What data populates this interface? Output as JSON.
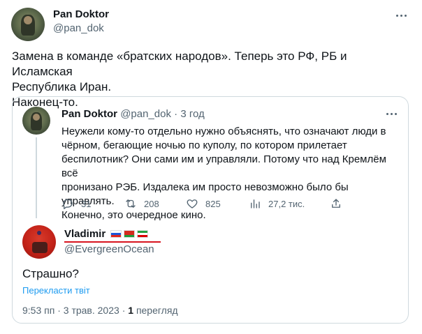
{
  "main_tweet": {
    "author_name": "Pan Doktor",
    "author_handle": "@pan_dok",
    "text_line1": "Замена в команде «братских народов». Теперь это РФ, РБ и Исламская",
    "text_line2": "Республика Иран.",
    "text_line3": "Наконец-то.",
    "more_icon": "more-horizontal-icon"
  },
  "quoted_tweet": {
    "author_name": "Pan Doktor",
    "author_handle": "@pan_dok",
    "separator": "·",
    "time": "3 год",
    "text_line1": "Неужели кому-то отдельно нужно объяснять, что означают люди в",
    "text_line2": "чёрном, бегающие ночью по куполу, по котором прилетает",
    "text_line3": "беспилотник? Они сами им и управляли. Потому что над Кремлём всё",
    "text_line4": "пронизано РЭБ. Издалека им просто невозможно было бы управлять.",
    "text_line5": "Конечно, это очередное кино.",
    "actions": {
      "reply_count": "31",
      "retweet_count": "208",
      "like_count": "825",
      "views_count": "27,2 тис."
    }
  },
  "reply_tweet": {
    "author_name": "Vladimir",
    "author_handle": "@EvergreenOcean",
    "flags": [
      "russia-flag",
      "belarus-flag",
      "iran-flag"
    ],
    "underline_color": "#d7141f",
    "text": "Страшно?",
    "translate_label": "Перекласти твіт",
    "time": "9:53 пп",
    "separator1": "·",
    "date": "3 трав. 2023",
    "separator2": "·",
    "views_number": "1",
    "views_label": "перегляд"
  },
  "colors": {
    "text_primary": "#0f1419",
    "text_secondary": "#536471",
    "link": "#1d9bf0",
    "border": "#cfd9de"
  }
}
